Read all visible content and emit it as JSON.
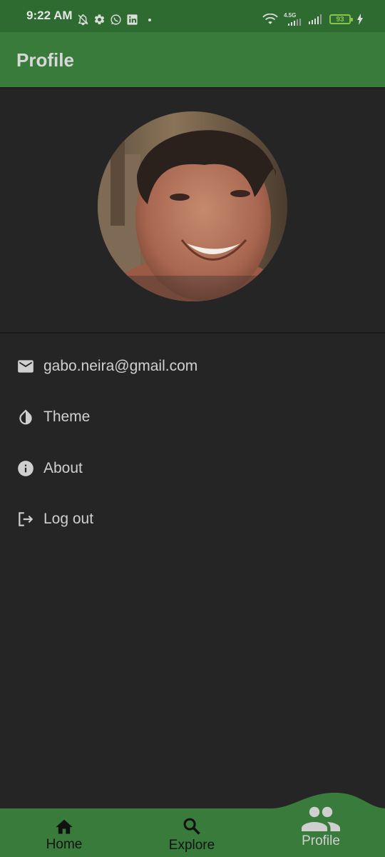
{
  "status_bar": {
    "time": "9:22 AM",
    "left_icons": [
      "bell-off-icon",
      "gear-icon",
      "whatsapp-icon",
      "linkedin-icon",
      "dot-icon"
    ],
    "network_label": "4.5G",
    "battery_level": "93"
  },
  "app_bar": {
    "title": "Profile"
  },
  "profile": {
    "email": "gabo.neira@gmail.com"
  },
  "menu": {
    "theme_label": "Theme",
    "about_label": "About",
    "logout_label": "Log out"
  },
  "bottom_nav": {
    "items": [
      {
        "label": "Home",
        "icon": "home-icon"
      },
      {
        "label": "Explore",
        "icon": "search-icon"
      },
      {
        "label": "Profile",
        "icon": "people-icon"
      }
    ],
    "selected": "Profile"
  },
  "colors": {
    "status_bar": "#2e6b31",
    "app_bar": "#387b3b",
    "background": "#252525",
    "text": "#d0d0d0",
    "battery": "#8bc34a"
  }
}
